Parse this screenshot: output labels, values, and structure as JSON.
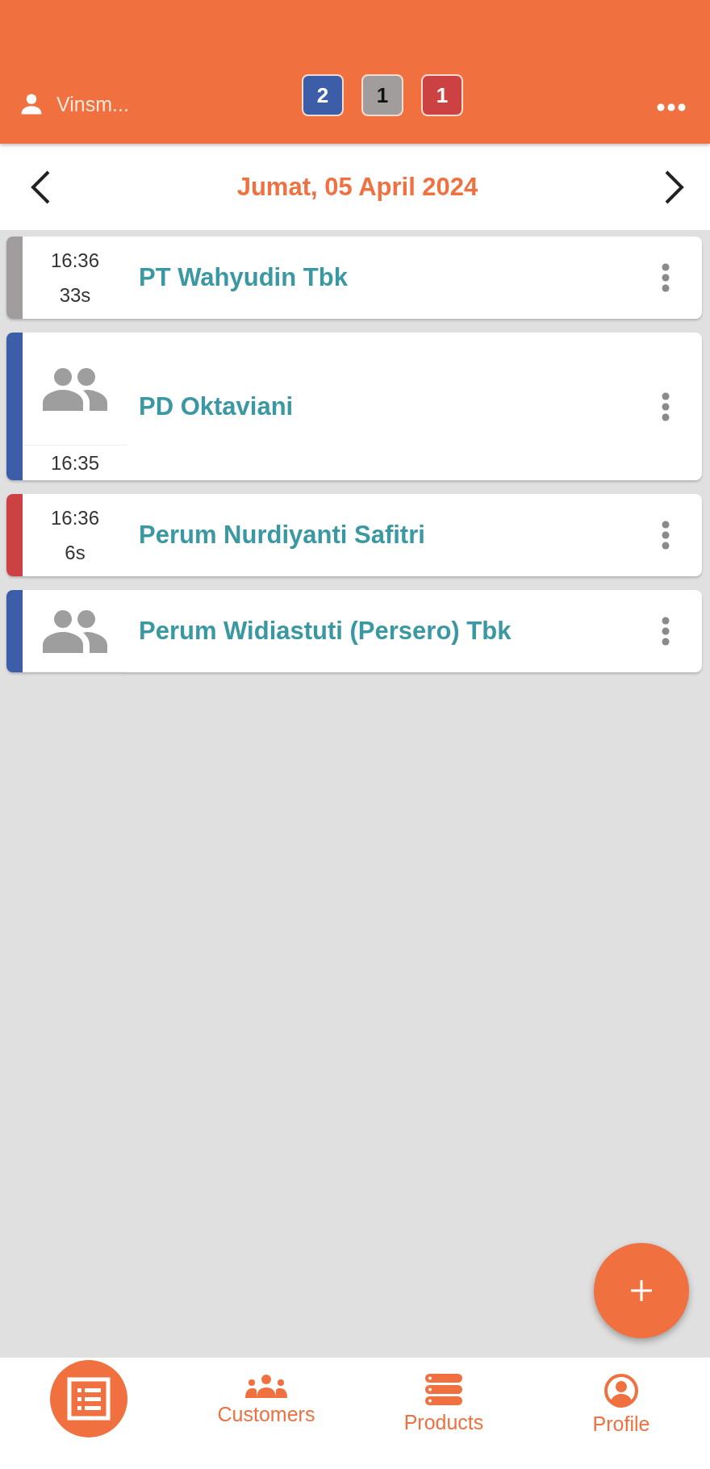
{
  "header": {
    "user_name": "Vinsm...",
    "badges": [
      {
        "count": "2",
        "color": "#3c5ea8"
      },
      {
        "count": "1",
        "color": "#a19d9d"
      },
      {
        "count": "1",
        "color": "#cc4242"
      }
    ]
  },
  "date_bar": {
    "date": "Jumat, 05 April 2024"
  },
  "visits": [
    {
      "kind": "timer",
      "color": "#a19d9d",
      "time": "16:36",
      "duration": "33s",
      "name": "PT Wahyudin Tbk"
    },
    {
      "kind": "group",
      "color": "#3c5ea8",
      "time": "16:35",
      "name": "PD Oktaviani"
    },
    {
      "kind": "timer",
      "color": "#cc4242",
      "time": "16:36",
      "duration": "6s",
      "name": "Perum Nurdiyanti Safitri"
    },
    {
      "kind": "group",
      "color": "#3c5ea8",
      "name": "Perum Widiastuti (Persero) Tbk"
    }
  ],
  "nav": [
    {
      "kind": "list",
      "selected": true
    },
    {
      "kind": "people",
      "label": "Customers",
      "selected": false
    },
    {
      "kind": "stack",
      "label": "Products",
      "selected": false
    },
    {
      "kind": "profile",
      "label": "Profile",
      "selected": false
    }
  ]
}
